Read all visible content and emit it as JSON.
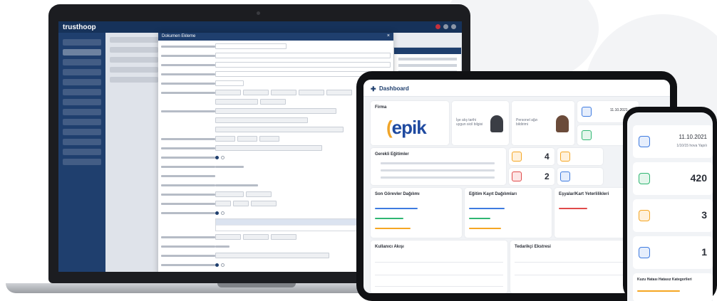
{
  "laptop": {
    "brand": "trusthoop",
    "modal_title": "Dokumen Ekleme",
    "modal_close": "×"
  },
  "tablet": {
    "header_icon": "✚",
    "header_title": "Dashboard",
    "company_card_title": "Firma",
    "logo_first": "(",
    "logo_rest": "epik",
    "person1": "İşe alış tarihi uygun sicil bilgisi",
    "person2": "Personel ağzı bildirimi",
    "date_label": "11.10.2021",
    "stat1_value": "4",
    "stat2_value": "2",
    "list_title": "Gerekli Eğitimler",
    "sections": [
      "Son Görevler Dağılımı",
      "Eğitim Kayıt Dağılımları",
      "Eşyalar/Kart Yeterlilikleri"
    ],
    "bottom_sections": [
      "Kullanıcı Akışı",
      "Tedarikçi Ekstresi"
    ]
  },
  "phone": {
    "date": "11.10.2021",
    "date_sub": "1/10/15 hova Yapılı",
    "card2_value": "420",
    "card3_value": "3",
    "card4_value": "1",
    "bottom_title": "Kuzu Hatası Hatasız Kategorileri"
  },
  "colors": {
    "navy": "#1f3f6e",
    "logo_blue": "#1f4aa0",
    "logo_orange": "#f0a52a",
    "green": "#2fb672",
    "orange": "#f5a623",
    "red": "#e04a4a",
    "blue": "#3e7be0"
  }
}
